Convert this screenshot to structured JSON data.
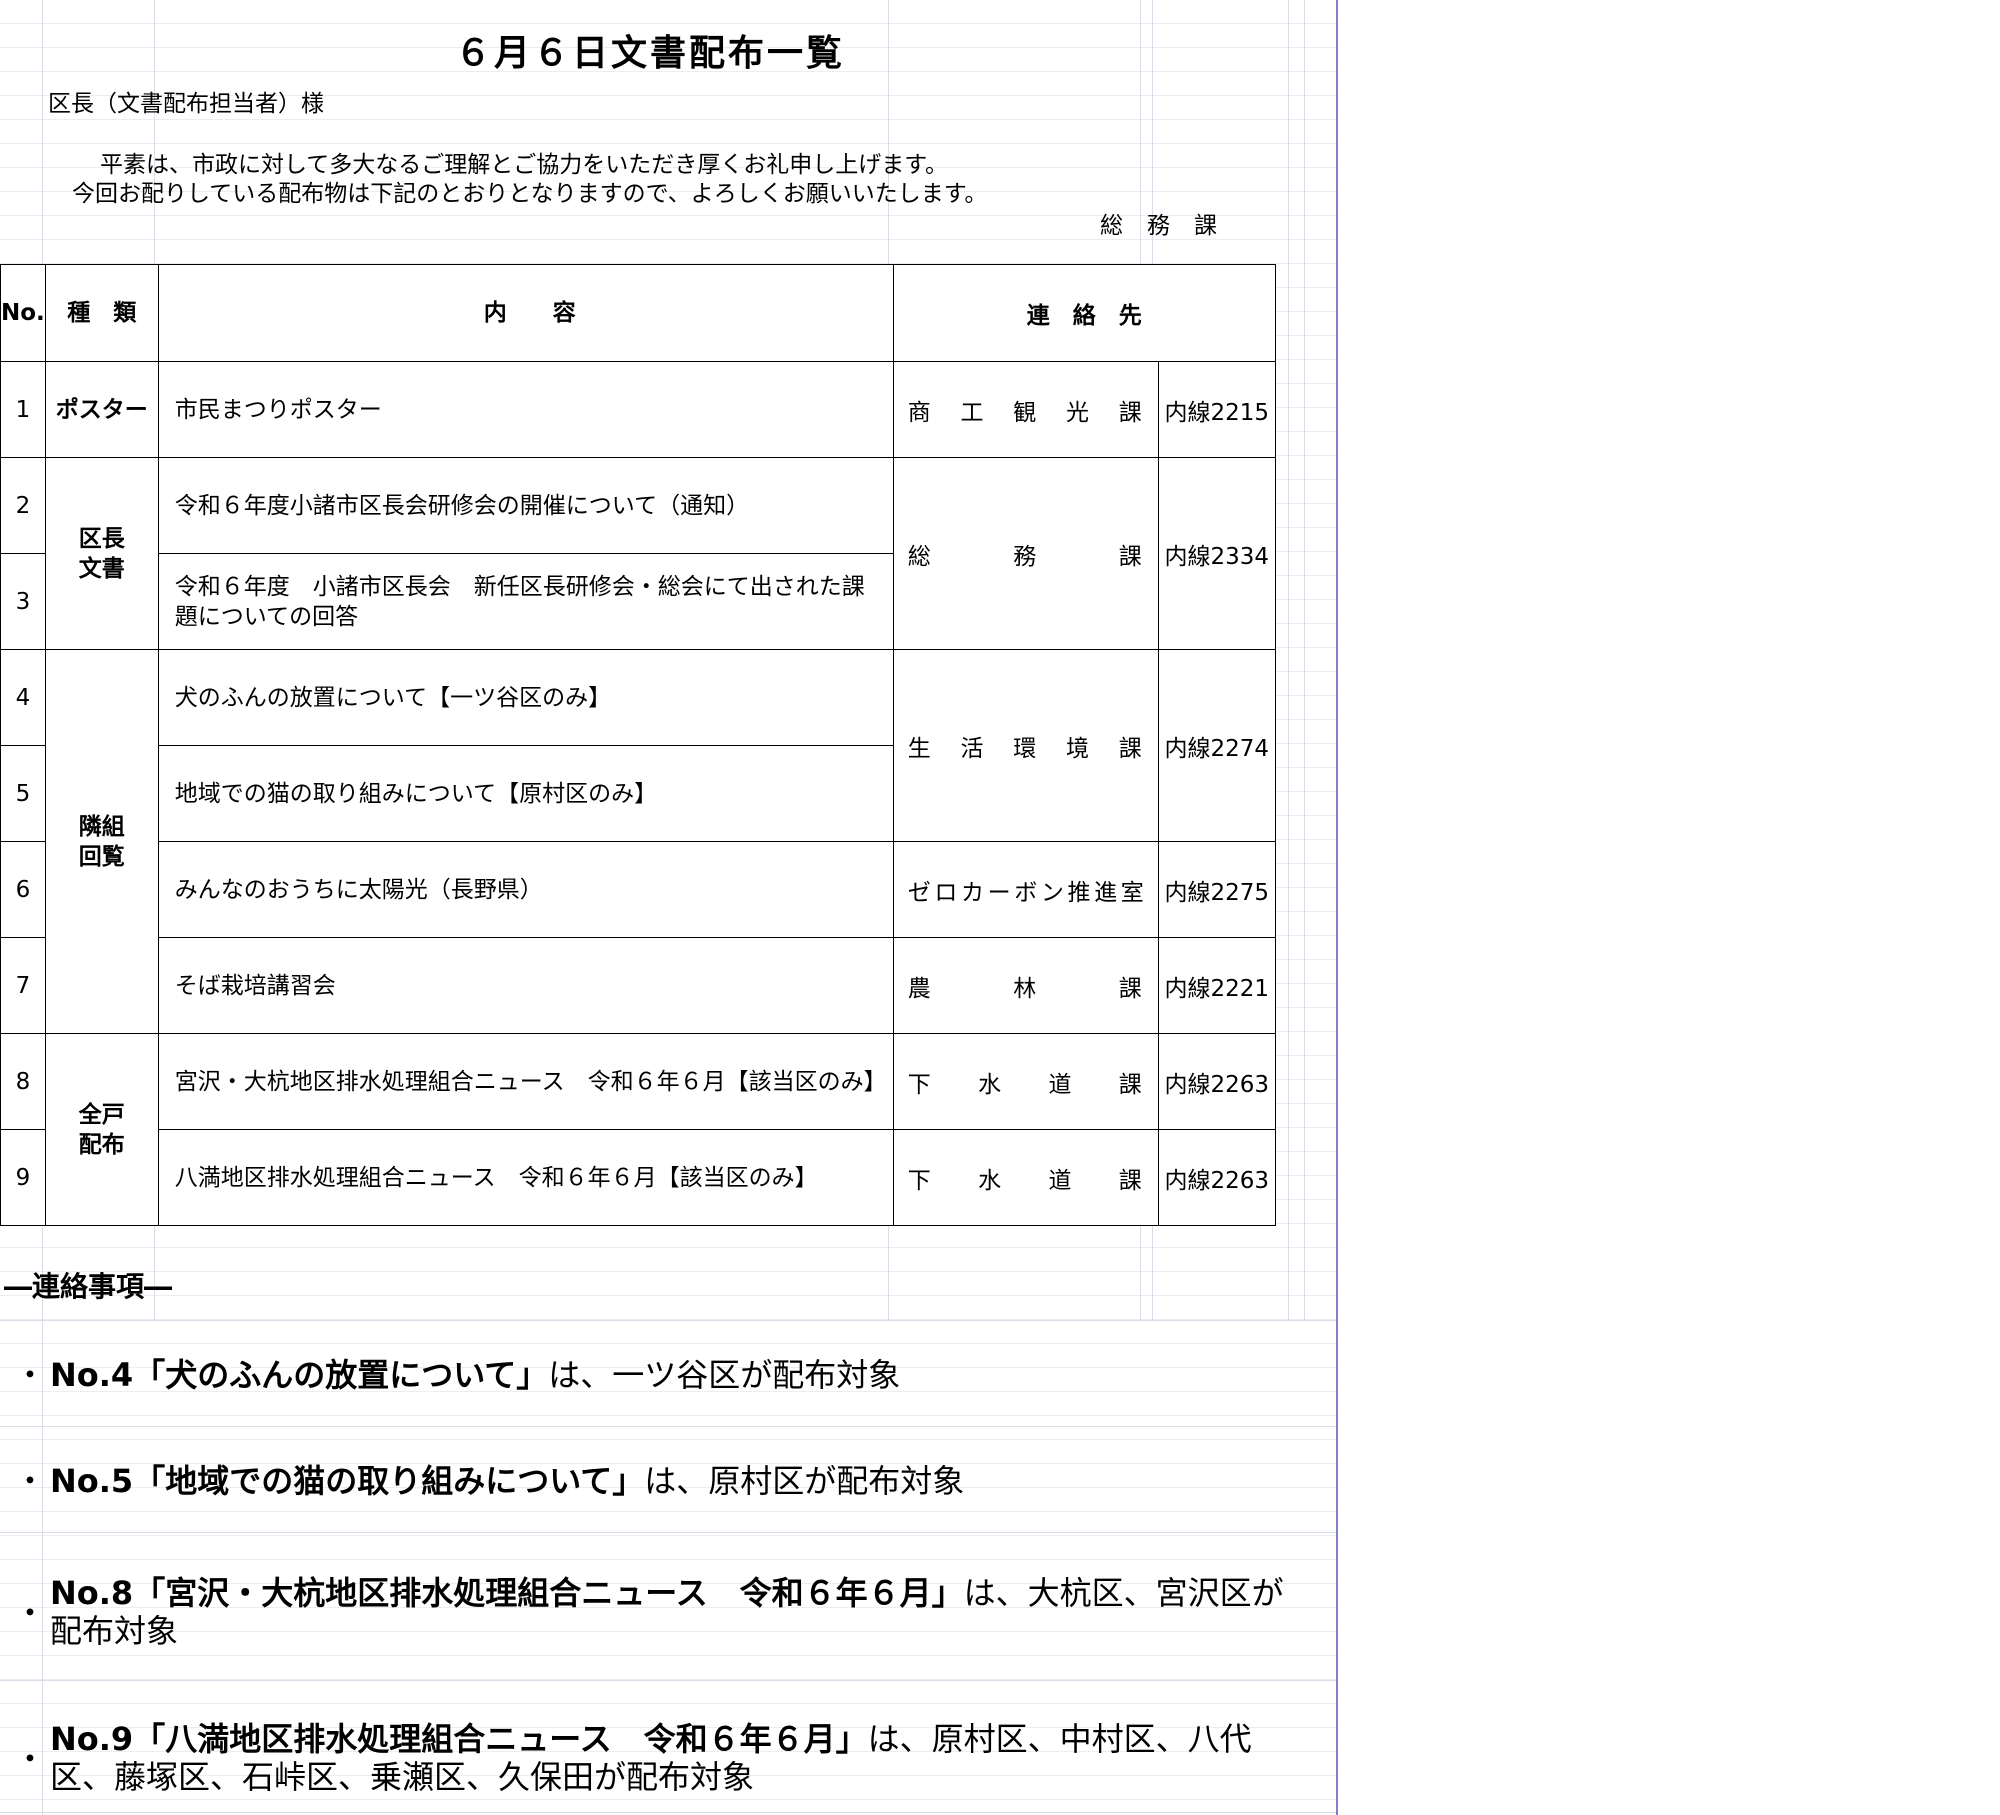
{
  "title": "６月６日文書配布一覧",
  "addressee": "区長（文書配布担当者）様",
  "greeting_line1": "平素は、市政に対して多大なるご理解とご協力をいただき厚くお礼申し上げます。",
  "greeting_line2": "今回お配りしている配布物は下記のとおりとなりますので、よろしくお願いいたします。",
  "department": "総務課",
  "table": {
    "headers": {
      "no": "No.",
      "type": "種　類",
      "content": "内　　容",
      "contact": "連　絡　先"
    },
    "rows": [
      {
        "no": "1",
        "type": "ポスター",
        "content": "市民まつりポスター",
        "dept": "商工観光課",
        "ext": "内線2215"
      },
      {
        "no": "2",
        "type": "区長\n文書",
        "content": "令和６年度小諸市区長会研修会の開催について（通知）",
        "dept": "総務課",
        "ext": "内線2334"
      },
      {
        "no": "3",
        "content": "令和６年度　小諸市区長会　新任区長研修会・総会にて出された課題についての回答"
      },
      {
        "no": "4",
        "type": "隣組\n回覧",
        "content": "犬のふんの放置について【一ツ谷区のみ】",
        "dept": "生活環境課",
        "ext": "内線2274"
      },
      {
        "no": "5",
        "content": "地域での猫の取り組みについて【原村区のみ】"
      },
      {
        "no": "6",
        "content": "みんなのおうちに太陽光（長野県）",
        "dept": "ゼロカーボン推進室",
        "ext": "内線2275"
      },
      {
        "no": "7",
        "content": "そば栽培講習会",
        "dept": "農林課",
        "ext": "内線2221"
      },
      {
        "no": "8",
        "type": "全戸\n配布",
        "content": "宮沢・大杭地区排水処理組合ニュース　令和６年６月【該当区のみ】",
        "dept": "下水道課",
        "ext": "内線2263"
      },
      {
        "no": "9",
        "content": "八満地区排水処理組合ニュース　令和６年６月【該当区のみ】",
        "dept": "下水道課",
        "ext": "内線2263"
      }
    ]
  },
  "notes_title": "―連絡事項―",
  "notes": [
    {
      "bullet": "・",
      "lead": "No.4「犬のふんの放置について」",
      "rest": "は、一ツ谷区が配布対象"
    },
    {
      "bullet": "・",
      "lead": "No.5「地域での猫の取り組みについて」",
      "rest": "は、原村区が配布対象"
    },
    {
      "bullet": "・",
      "lead": "No.8「宮沢・大杭地区排水処理組合ニュース　令和６年６月」",
      "rest": "は、大杭区、宮沢区が配布対象"
    },
    {
      "bullet": "・",
      "lead": "No.9「八満地区排水処理組合ニュース　令和６年６月」",
      "rest": "は、原村区、中村区、八代区、藤塚区、石峠区、乗瀬区、久保田が配布対象"
    }
  ]
}
